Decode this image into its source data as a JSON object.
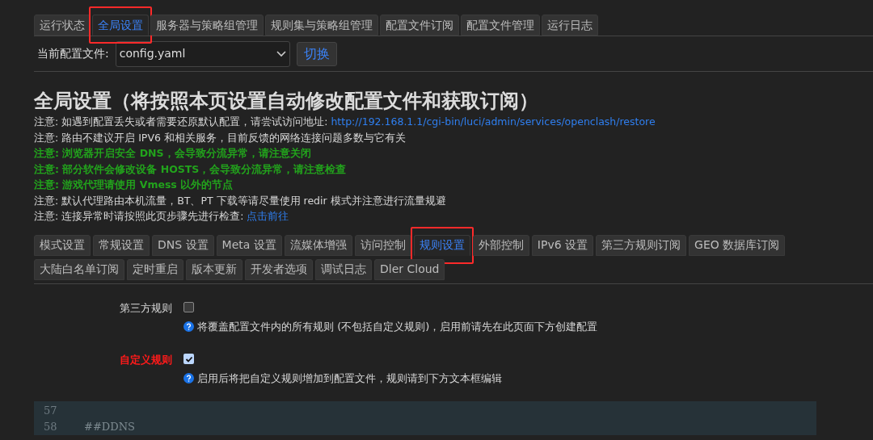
{
  "top_tabs": [
    {
      "label": "运行状态",
      "selected": false,
      "annotated": false
    },
    {
      "label": "全局设置",
      "selected": true,
      "annotated": true
    },
    {
      "label": "服务器与策略组管理",
      "selected": false,
      "annotated": false
    },
    {
      "label": "规则集与策略组管理",
      "selected": false,
      "annotated": false
    },
    {
      "label": "配置文件订阅",
      "selected": false,
      "annotated": false
    },
    {
      "label": "配置文件管理",
      "selected": false,
      "annotated": false
    },
    {
      "label": "运行日志",
      "selected": false,
      "annotated": false
    }
  ],
  "config_file": {
    "label": "当前配置文件:",
    "value": "config.yaml",
    "button": "切换"
  },
  "heading": "全局设置（将按照本页设置自动修改配置文件和获取订阅）",
  "notes": [
    {
      "kind": "plain",
      "text": "注意: 如遇到配置丢失或者需要还原默认配置，请尝试访问地址:",
      "link": "http://192.168.1.1/cgi-bin/luci/admin/services/openclash/restore"
    },
    {
      "kind": "plain",
      "text": "注意: 路由不建议开启 IPV6 和相关服务，目前反馈的网络连接问题多数与它有关"
    },
    {
      "kind": "warning",
      "text": "注意: 浏览器开启安全 DNS，会导致分流异常，请注意关闭"
    },
    {
      "kind": "warning",
      "text": "注意: 部分软件会修改设备 HOSTS，会导致分流异常，请注意检查"
    },
    {
      "kind": "warning",
      "text": "注意: 游戏代理请使用 Vmess 以外的节点"
    },
    {
      "kind": "plain",
      "text": "注意: 默认代理路由本机流量，BT、PT 下载等请尽量使用 redir 模式并注意进行流量规避"
    },
    {
      "kind": "plain",
      "text": "注意: 连接异常时请按照此页步骤先进行检查:",
      "link": "点击前往"
    }
  ],
  "section_tabs": [
    [
      {
        "label": "模式设置",
        "selected": false,
        "annotated": false
      },
      {
        "label": "常规设置",
        "selected": false,
        "annotated": false
      },
      {
        "label": "DNS 设置",
        "selected": false,
        "annotated": false
      },
      {
        "label": "Meta 设置",
        "selected": false,
        "annotated": false
      },
      {
        "label": "流媒体增强",
        "selected": false,
        "annotated": false
      },
      {
        "label": "访问控制",
        "selected": false,
        "annotated": false
      },
      {
        "label": "规则设置",
        "selected": true,
        "annotated": true
      },
      {
        "label": "外部控制",
        "selected": false,
        "annotated": false
      },
      {
        "label": "IPv6 设置",
        "selected": false,
        "annotated": false
      },
      {
        "label": "第三方规则订阅",
        "selected": false,
        "annotated": false
      },
      {
        "label": "GEO 数据库订阅",
        "selected": false,
        "annotated": false
      }
    ],
    [
      {
        "label": "大陆白名单订阅",
        "selected": false,
        "annotated": false
      },
      {
        "label": "定时重启",
        "selected": false,
        "annotated": false
      },
      {
        "label": "版本更新",
        "selected": false,
        "annotated": false
      },
      {
        "label": "开发者选项",
        "selected": false,
        "annotated": false
      },
      {
        "label": "调试日志",
        "selected": false,
        "annotated": false
      },
      {
        "label": "Dler Cloud",
        "selected": false,
        "annotated": false
      }
    ]
  ],
  "options": [
    {
      "label": "第三方规则",
      "emphasized": false,
      "checked": false,
      "help": "将覆盖配置文件内的所有规则 (不包括自定义规则)，启用前请先在此页面下方创建配置"
    },
    {
      "label": "自定义规则",
      "emphasized": true,
      "checked": true,
      "help": "启用后将把自定义规则增加到配置文件，规则请到下方文本框编辑"
    }
  ],
  "editor_lines": [
    {
      "number": "57"
    },
    {
      "number": "58",
      "text": "##DDNS"
    }
  ]
}
